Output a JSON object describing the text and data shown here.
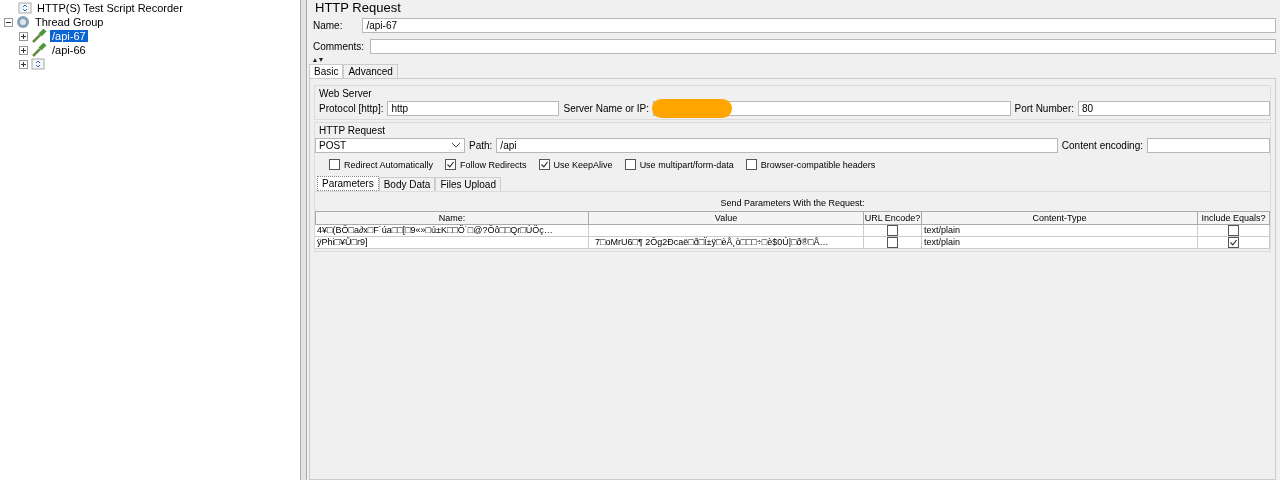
{
  "tree": [
    {
      "label": "HTTP(S) Test Script Recorder",
      "kind": "recorder"
    },
    {
      "label": "Thread Group",
      "kind": "thread-group",
      "expanded": true,
      "children": [
        {
          "label": "/api-67",
          "kind": "sampler",
          "selected": true,
          "expanded": false
        },
        {
          "label": "/api-66",
          "kind": "sampler",
          "selected": false,
          "expanded": false
        },
        {
          "kind": "controller",
          "expanded": false
        }
      ]
    }
  ],
  "panel": {
    "title": "HTTP Request",
    "name_label": "Name:",
    "name": "/api-67",
    "comments_label": "Comments:"
  },
  "tabs": [
    {
      "label": "Basic",
      "selected": true
    },
    {
      "label": "Advanced",
      "selected": false
    }
  ],
  "web_server": {
    "title": "Web Server",
    "protocol_label": "Protocol [http]:",
    "protocol": "http",
    "server_label": "Server Name or IP:",
    "server_redacted": true,
    "port_label": "Port Number:",
    "port": "80"
  },
  "http_request": {
    "title": "HTTP Request",
    "method": "POST",
    "path_label": "Path:",
    "path": "/api",
    "encoding_label": "Content encoding:"
  },
  "options": [
    {
      "label": "Redirect Automatically",
      "checked": false
    },
    {
      "label": "Follow Redirects",
      "checked": true
    },
    {
      "label": "Use KeepAlive",
      "checked": true
    },
    {
      "label": "Use multipart/form-data",
      "checked": false
    },
    {
      "label": "Browser-compatible headers",
      "checked": false
    }
  ],
  "sub_tabs": [
    {
      "label": "Parameters",
      "selected": true
    },
    {
      "label": "Body Data",
      "selected": false
    },
    {
      "label": "Files Upload",
      "selected": false
    }
  ],
  "table": {
    "caption": "Send Parameters With the Request:",
    "columns": [
      "Name:",
      "Value",
      "URL Encode?",
      "Content-Type",
      "Include Equals?"
    ],
    "rows": [
      {
        "name": "4¥□(BÖ□a∂x□F˙úa□□[□9«»□ú±K□□Ö˙□@?Öô□□Qr□ÚÖç…",
        "value": "",
        "url_encode": false,
        "content_type": "text/plain",
        "include_equals": false
      },
      {
        "name": "ÿPhi□¥Ů□r9]",
        "value": "7□oMrU6□¶ 2Õg2Ðcaë□ð□Ï±ÿ□èÅ¸ò□□□÷□è$0Ú|□ð®□Å…",
        "url_encode": false,
        "content_type": "text/plain",
        "include_equals": true
      }
    ]
  }
}
